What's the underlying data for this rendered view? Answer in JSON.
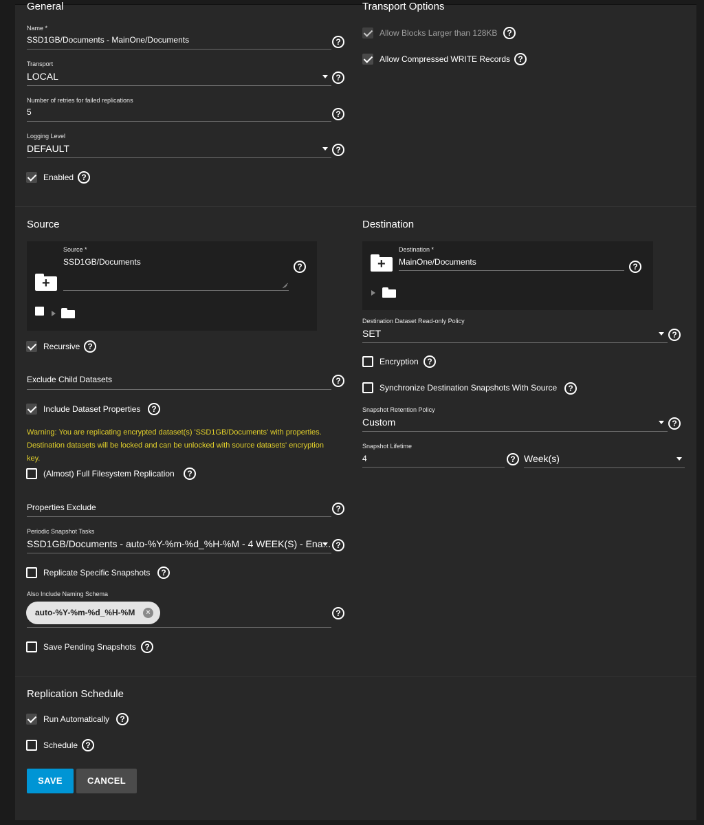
{
  "general": {
    "title": "General",
    "name_label": "Name *",
    "name_value": "SSD1GB/Documents - MainOne/Documents",
    "transport_label": "Transport",
    "transport_value": "LOCAL",
    "retries_label": "Number of retries for failed replications",
    "retries_value": "5",
    "logging_label": "Logging Level",
    "logging_value": "DEFAULT",
    "enabled_label": "Enabled",
    "enabled_checked": true
  },
  "transport_options": {
    "title": "Transport Options",
    "allow_blocks_label": "Allow Blocks Larger than 128KB",
    "allow_blocks_checked": true,
    "allow_blocks_disabled": true,
    "allow_compressed_label": "Allow Compressed WRITE Records",
    "allow_compressed_checked": true
  },
  "source": {
    "title": "Source",
    "source_label": "Source *",
    "source_value": "SSD1GB/Documents",
    "recursive_label": "Recursive",
    "recursive_checked": true,
    "exclude_child_label": "Exclude Child Datasets",
    "include_props_label": "Include Dataset Properties",
    "include_props_checked": true,
    "warning_text": "Warning: You are replicating encrypted dataset(s) 'SSD1GB/Documents' with properties. Destination datasets will be locked and can be unlocked with source datasets' encryption key.",
    "full_fs_label": "(Almost) Full Filesystem Replication",
    "full_fs_checked": false,
    "props_exclude_label": "Properties Exclude",
    "periodic_label": "Periodic Snapshot Tasks",
    "periodic_value": "SSD1GB/Documents - auto-%Y-%m-%d_%H-%M - 4 WEEK(S) - Ena...",
    "replicate_specific_label": "Replicate Specific Snapshots",
    "replicate_specific_checked": false,
    "naming_schema_label": "Also Include Naming Schema",
    "naming_schema_chip": "auto-%Y-%m-%d_%H-%M",
    "save_pending_label": "Save Pending Snapshots",
    "save_pending_checked": false
  },
  "destination": {
    "title": "Destination",
    "dest_label": "Destination *",
    "dest_value": "MainOne/Documents",
    "readonly_label": "Destination Dataset Read-only Policy",
    "readonly_value": "SET",
    "encryption_label": "Encryption",
    "encryption_checked": false,
    "sync_label": "Synchronize Destination Snapshots With Source",
    "sync_checked": false,
    "retention_label": "Snapshot Retention Policy",
    "retention_value": "Custom",
    "lifetime_label": "Snapshot Lifetime",
    "lifetime_value": "4",
    "lifetime_unit": "Week(s)"
  },
  "schedule": {
    "title": "Replication Schedule",
    "run_auto_label": "Run Automatically",
    "run_auto_checked": true,
    "schedule_label": "Schedule",
    "schedule_checked": false
  },
  "actions": {
    "save_label": "SAVE",
    "cancel_label": "CANCEL"
  },
  "colors": {
    "background": "#1b1b1b",
    "card": "#282828",
    "primary": "#0095d5",
    "warning": "#e2d02b"
  }
}
